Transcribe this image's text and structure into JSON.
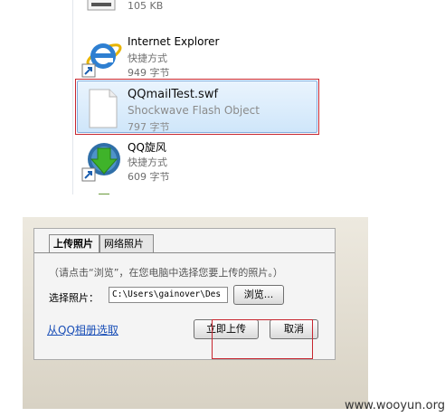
{
  "explorer": {
    "top_item": {
      "size": "105 KB"
    },
    "items": [
      {
        "name": "Internet Explorer",
        "type": "快捷方式",
        "size": "949 字节",
        "icon": "internet-explorer-icon"
      },
      {
        "name": "QQmailTest.swf",
        "type": "Shockwave Flash Object",
        "size": "797 字节",
        "icon": "swf-file-icon",
        "selected": true
      },
      {
        "name": "QQ旋风",
        "type": "快捷方式",
        "size": "609 字节",
        "icon": "qq-xuanfeng-icon"
      }
    ]
  },
  "dialog": {
    "tabs": [
      {
        "label": "上传照片",
        "active": true
      },
      {
        "label": "网络照片",
        "active": false
      }
    ],
    "hint": "（请点击“浏览”，在您电脑中选择您要上传的照片。）",
    "choose_label": "选择照片：",
    "path_value": "C:\\Users\\gainover\\Des",
    "browse_label": "浏览...",
    "album_link": "从QQ相册选取",
    "upload_label": "立即上传",
    "cancel_label": "取消"
  },
  "watermark": "www.wooyun.org",
  "colors": {
    "highlight": "#cfe6fa",
    "annotation_red": "#c7262f",
    "link": "#1a4fb7"
  }
}
